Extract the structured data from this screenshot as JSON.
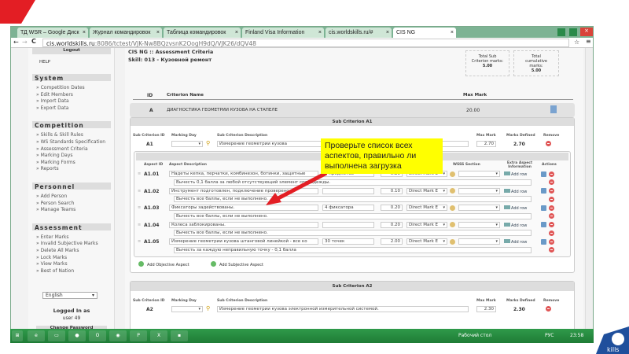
{
  "browser": {
    "tabs": [
      "ТД WSR – Google Диск",
      "Журнал командировок",
      "Таблица командировок",
      "Finland Visa Information",
      "cis.worldskills.ru/#",
      "CIS NG"
    ],
    "url_host": "cis.worldskills.ru",
    "url_path": ":8086/tctest/VJK-Nw8BQzvsnK2OogH9dQ/VJK26/dQV48"
  },
  "sidebar": {
    "logout": "Logout",
    "help": "HELP",
    "sections": [
      {
        "title": "System",
        "items": [
          "» Competition Dates",
          "» Edit Members",
          "» Import Data",
          "» Export Data"
        ]
      },
      {
        "title": "Competition",
        "items": [
          "» Skills & Skill Rules",
          "» WS Standards Specification",
          "» Assessment Criteria",
          "» Marking Days",
          "» Marking Forms",
          "» Reports"
        ]
      },
      {
        "title": "Personnel",
        "items": [
          "» Add Person",
          "» Person Search",
          "» Manage Teams"
        ]
      },
      {
        "title": "Assessment",
        "items": [
          "» Enter Marks",
          "» Invalid Subjective Marks",
          "» Delete All Marks",
          "» Lock Marks",
          "» View Marks",
          "» Best of Nation"
        ]
      }
    ],
    "language": "English",
    "logged_in_label": "Logged In as",
    "user": "user 49",
    "change_password": "Change Password"
  },
  "main": {
    "title": "CIS NG :: Assessment Criteria",
    "skill": "Skill: 013 - Кузовной ремонт",
    "total_sub_label": "Total Sub Criterion marks:",
    "total_sub_value": "5.00",
    "total_cum_label": "Total cumulative marks:",
    "total_cum_value": "5.00",
    "col_id": "ID",
    "col_name": "Criterion Name",
    "col_max": "Max Mark",
    "criterion": {
      "id": "A",
      "name": "ДИАГНОСТИКА ГЕОМЕТРИИ КУЗОВА НА СТАПЕЛЕ",
      "max": "20.00"
    },
    "sub_headers": [
      "Sub Criterion ID",
      "Marking Day",
      "Sub Criterion Description",
      "Max Mark",
      "Marks Defined",
      "Remove"
    ],
    "aspect_headers": [
      "Aspect ID",
      "Aspect Description",
      "WSSS Section",
      "Extra Aspect Information",
      "Actions"
    ],
    "sub1": {
      "title": "Sub Criterion A1",
      "id": "A1",
      "desc": "Измерение геометрии кузова",
      "max": "2.70",
      "defined": "2.70"
    },
    "aspects": [
      {
        "id": "A1.01",
        "desc": "Надеты кепка, перчатки, комбинезон, ботинки, защитные",
        "req": "5 предметов",
        "max": "0.20",
        "type": "Direct Mark E",
        "extra": "Add row",
        "note": "Вычесть 0,1 балла за любой отсутствующий элемент спецодежды."
      },
      {
        "id": "A1.02",
        "desc": "Инструмент подготовлен, подключение проверено.",
        "req": "",
        "max": "0.10",
        "type": "Direct Mark E",
        "extra": "Add row",
        "note": "Вычесть все баллы, если не выполнено."
      },
      {
        "id": "A1.03",
        "desc": "Фиксаторы задействованы.",
        "req": "4 фиксатора",
        "max": "0.20",
        "type": "Direct Mark E",
        "extra": "Add row",
        "note": "Вычесть все баллы, если не выполнено."
      },
      {
        "id": "A1.04",
        "desc": "Колеса заблокированы.",
        "req": "",
        "max": "0.20",
        "type": "Direct Mark E",
        "extra": "Add row",
        "note": "Вычесть все баллы, если не выполнено."
      },
      {
        "id": "A1.05",
        "desc": "Измерение геометрии кузова штанговой линейкой - все ко",
        "req": "30 точек",
        "max": "2.00",
        "type": "Direct Mark E",
        "extra": "Add row",
        "note": "Вычесть за каждую неправильную точку - 0,1 балла"
      }
    ],
    "add_objective": "Add Objective Aspect",
    "add_subjective": "Add Subjective Aspect",
    "sub2": {
      "title": "Sub Criterion A2",
      "id": "A2",
      "desc": "Измерение геометрии кузова электронной измерительной системой.",
      "max": "2.30",
      "defined": "2.30"
    }
  },
  "annotation": "Проверьте список всех аспектов, правильно ли выполнена загрузка",
  "taskbar": {
    "desktop": "Рабочий стол",
    "lang": "РУС",
    "time": "23:58"
  },
  "colors": {
    "accent_red": "#e31e24",
    "taskbar_green": "#2f9a4a",
    "note_yellow": "#ffff00"
  }
}
